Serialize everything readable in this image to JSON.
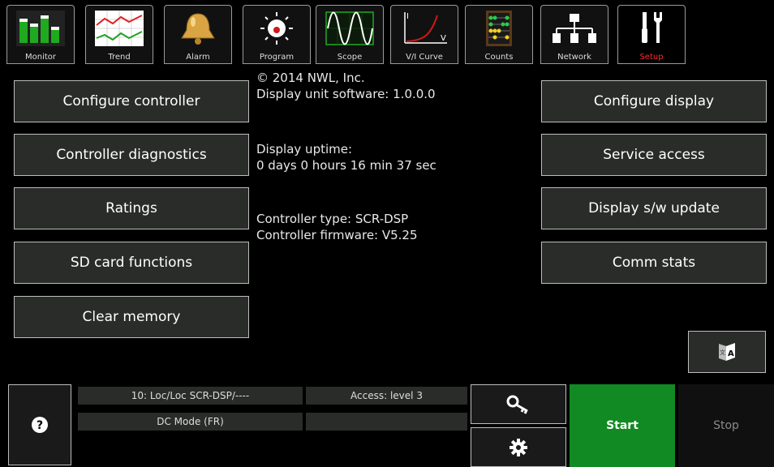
{
  "tabs": [
    {
      "label": "Monitor",
      "icon": "monitor-icon"
    },
    {
      "label": "Trend",
      "icon": "trend-icon"
    },
    {
      "label": "Alarm",
      "icon": "alarm-bell-icon"
    },
    {
      "label": "Program",
      "icon": "program-icon"
    },
    {
      "label": "Scope",
      "icon": "scope-icon"
    },
    {
      "label": "V/I Curve",
      "icon": "vi-curve-icon"
    },
    {
      "label": "Counts",
      "icon": "counts-abacus-icon"
    },
    {
      "label": "Network",
      "icon": "network-icon"
    },
    {
      "label": "Setup",
      "icon": "setup-tools-icon",
      "active": true
    }
  ],
  "left_buttons": [
    "Configure controller",
    "Controller diagnostics",
    "Ratings",
    "SD card functions",
    "Clear memory"
  ],
  "right_buttons": [
    "Configure display",
    "Service access",
    "Display s/w update",
    "Comm stats"
  ],
  "info": {
    "copyright": "© 2014 NWL, Inc.",
    "software": "Display unit software: 1.0.0.0",
    "uptime_label": "Display uptime:",
    "uptime_value": "0 days 0 hours 16 min 37 sec",
    "controller_type": "Controller type: SCR-DSP",
    "controller_firmware": "Controller firmware: V5.25"
  },
  "status": {
    "unit": "10: Loc/Loc SCR-DSP/----",
    "access": "Access: level 3",
    "mode": "DC Mode (FR)",
    "empty": ""
  },
  "controls": {
    "start": "Start",
    "stop": "Stop"
  },
  "colors": {
    "start_green": "#128a23",
    "active_tab_label": "#ff2b2b",
    "button_bg": "#2a2c2a"
  }
}
